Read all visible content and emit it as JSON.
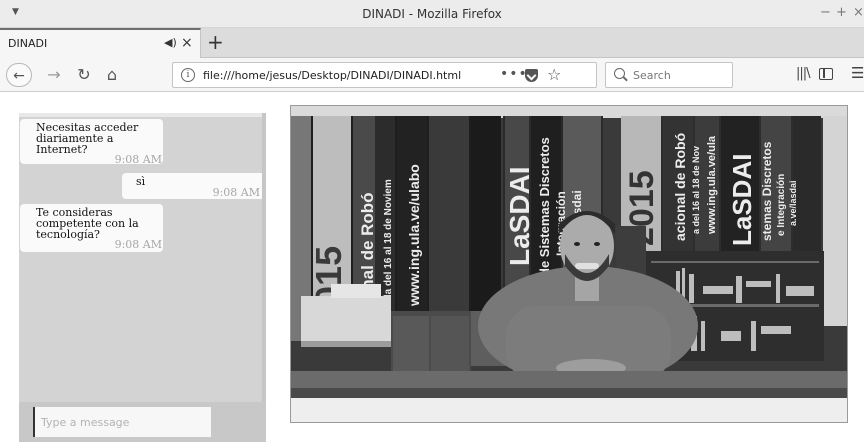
{
  "window": {
    "title": "DINADI - Mozilla Firefox",
    "controls": {
      "minimize": "−",
      "maximize": "+",
      "close": "×"
    }
  },
  "tabs": [
    {
      "label": "DINADI",
      "active": true
    }
  ],
  "toolbar": {
    "url": "file:///home/jesus/Desktop/DINADI/DINADI.html",
    "search_placeholder": "Search",
    "page_actions": "•••"
  },
  "chat": {
    "messages": [
      {
        "sender": "bot",
        "text": "Necesitas acceder diariamente a Internet?",
        "time": "9:08 AM"
      },
      {
        "sender": "user",
        "text": "sì",
        "time": "9:08 AM"
      },
      {
        "sender": "bot",
        "text": "Te consideras competente con la tecnología?",
        "time": "9:08 AM"
      }
    ],
    "input_placeholder": "Type a message"
  },
  "video": {
    "banners": [
      {
        "text": "2015"
      },
      {
        "text": "Nacional de Robó"
      },
      {
        "text": "Mérida del 16 al 18 de Noviem"
      },
      {
        "text": "www.ing.ula.ve/ulabo"
      },
      {
        "text": "LaSDAI"
      },
      {
        "text": "de Sistemas Discretos"
      },
      {
        "text": "Integración"
      },
      {
        "text": "asdai"
      },
      {
        "text": "2015"
      },
      {
        "text": "acional de Robó"
      },
      {
        "text": "a del 16 al 18 de Nov"
      },
      {
        "text": "www.ing.ula.ve/ula"
      },
      {
        "text": "LaSDAI"
      },
      {
        "text": "stemas Discretos"
      },
      {
        "text": "e Integración"
      },
      {
        "text": "a.ve/lasdai"
      }
    ]
  }
}
